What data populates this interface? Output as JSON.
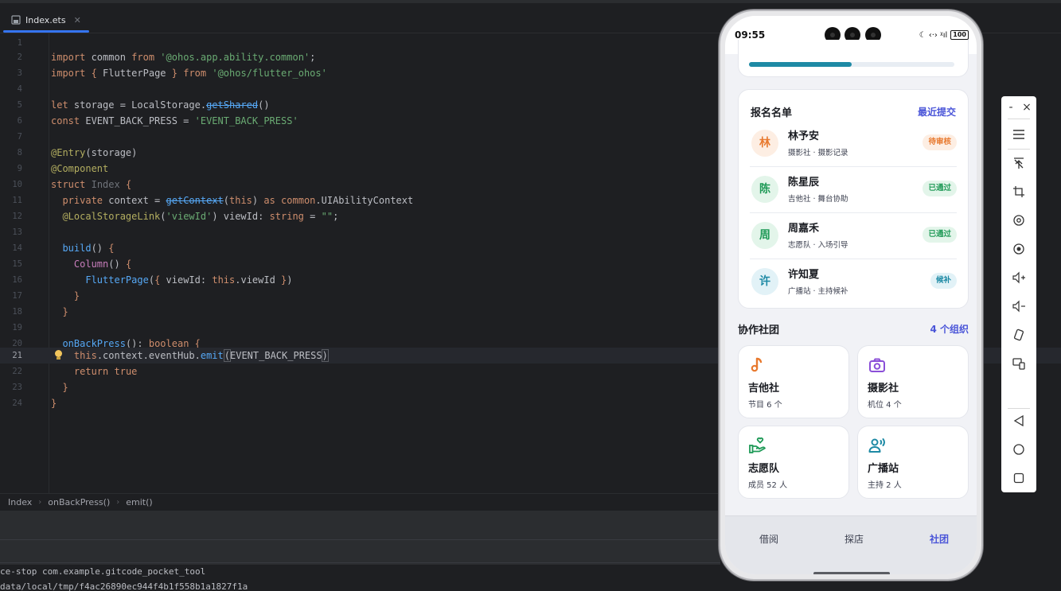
{
  "editor": {
    "tab": {
      "label": "Index.ets"
    },
    "current_line": 21,
    "breadcrumbs": [
      "Index",
      "onBackPress()",
      "emit()"
    ],
    "console_lines": [
      "ce-stop com.example.gitcode_pocket_tool",
      "data/local/tmp/f4ac26890ec944f4b1f558b1a1827f1a"
    ]
  },
  "phone": {
    "status_bar": {
      "time": "09:55",
      "battery": "100",
      "icons": "☾ ‹·› ᵡıl"
    },
    "progress_fraction": 0.5,
    "registration": {
      "title": "报名名单",
      "link": "最近提交",
      "entries": [
        {
          "avatar": "林",
          "name": "林予安",
          "detail": "摄影社 · 摄影记录",
          "status": "待审核",
          "status_color": "#e8792e",
          "status_bg": "#fdeee3",
          "avatar_color": "#e8792e",
          "avatar_bg": "#fdeee3"
        },
        {
          "avatar": "陈",
          "name": "陈星辰",
          "detail": "吉他社 · 舞台协助",
          "status": "已通过",
          "status_color": "#1f9a57",
          "status_bg": "#e3f5ea",
          "avatar_color": "#1f9a57",
          "avatar_bg": "#e3f5ea"
        },
        {
          "avatar": "周",
          "name": "周嘉禾",
          "detail": "志愿队 · 入场引导",
          "status": "已通过",
          "status_color": "#1f9a57",
          "status_bg": "#e3f5ea",
          "avatar_color": "#1f9a57",
          "avatar_bg": "#e3f5ea"
        },
        {
          "avatar": "许",
          "name": "许知夏",
          "detail": "广播站 · 主持候补",
          "status": "候补",
          "status_color": "#1e8aa5",
          "status_bg": "#e2f2f7",
          "avatar_color": "#1e8aa5",
          "avatar_bg": "#e2f2f7"
        }
      ]
    },
    "clubs": {
      "title": "协作社团",
      "link": "4 个组织",
      "items": [
        {
          "icon": "music-note-icon",
          "name": "吉他社",
          "detail": "节目 6 个",
          "color": "#e8792e"
        },
        {
          "icon": "camera-icon",
          "name": "摄影社",
          "detail": "机位 4 个",
          "color": "#8b4fd8"
        },
        {
          "icon": "volunteer-heart-hand-icon",
          "name": "志愿队",
          "detail": "成员 52 人",
          "color": "#1f9a57"
        },
        {
          "icon": "broadcast-person-icon",
          "name": "广播站",
          "detail": "主持 2 人",
          "color": "#1e8aa5"
        }
      ]
    },
    "bottom_nav": [
      {
        "label": "借阅",
        "active": false
      },
      {
        "label": "探店",
        "active": false
      },
      {
        "label": "社团",
        "active": true
      }
    ]
  },
  "emulator_toolbar": {
    "minimize": "-",
    "close": "×",
    "tools": [
      "menu-icon",
      "pin-icon",
      "crop-icon",
      "rotate-icon",
      "screenshot-icon",
      "volume-up-icon",
      "volume-down-icon",
      "rotate-device-icon",
      "multi-screen-icon",
      "back-icon",
      "home-icon",
      "recents-icon"
    ]
  },
  "colors": {
    "accent": "#4a55d8",
    "ide_bg": "#1e1f22",
    "tab_underline": "#3574f0"
  }
}
